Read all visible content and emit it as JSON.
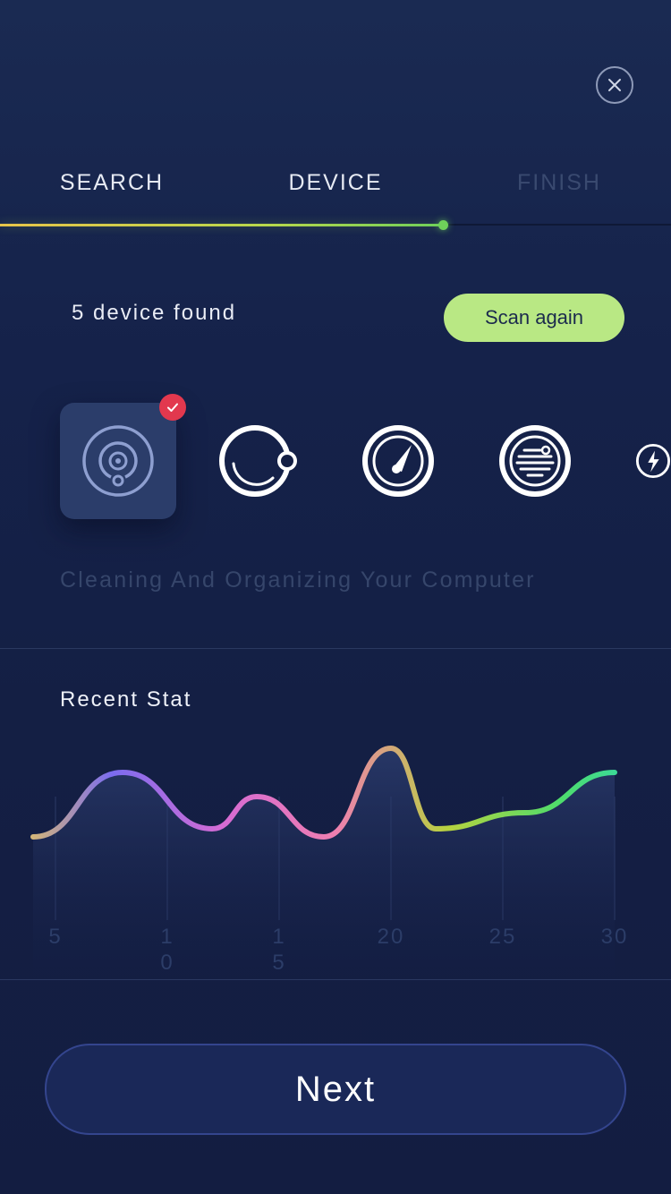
{
  "header": {
    "close_icon": "close-icon"
  },
  "steps": {
    "items": [
      {
        "label": "SEARCH",
        "state": "done"
      },
      {
        "label": "DEVICE",
        "state": "active"
      },
      {
        "label": "FINISH",
        "state": "pending"
      }
    ],
    "progress_fraction": 0.66
  },
  "scan": {
    "found_text": "5 device found",
    "button_label": "Scan again"
  },
  "devices": {
    "items": [
      {
        "icon": "robot-vacuum-icon",
        "selected": true
      },
      {
        "icon": "orbit-icon",
        "selected": false
      },
      {
        "icon": "speedometer-icon",
        "selected": false
      },
      {
        "icon": "speed-lines-icon",
        "selected": false
      },
      {
        "icon": "lightning-icon",
        "selected": false
      }
    ],
    "caption": "Cleaning And Organizing Your Computer"
  },
  "stats": {
    "title": "Recent Stat"
  },
  "chart_data": {
    "type": "line",
    "title": "Recent Stat",
    "x_ticks": [
      "5",
      "1\n0",
      "1\n5",
      "20",
      "25",
      "30"
    ],
    "x": [
      4,
      8,
      12,
      14,
      17,
      20,
      22,
      26,
      30
    ],
    "y": [
      2,
      6,
      2.5,
      4.5,
      2,
      7.5,
      2.5,
      3.5,
      6
    ],
    "grid": true,
    "legend": "none",
    "gradient_colors": [
      "#f7d34a",
      "#7b6cf0",
      "#d66bd3",
      "#ee7fb0",
      "#b7d23f",
      "#4fdc6b",
      "#2ad7c0"
    ]
  },
  "footer": {
    "next_label": "Next"
  }
}
